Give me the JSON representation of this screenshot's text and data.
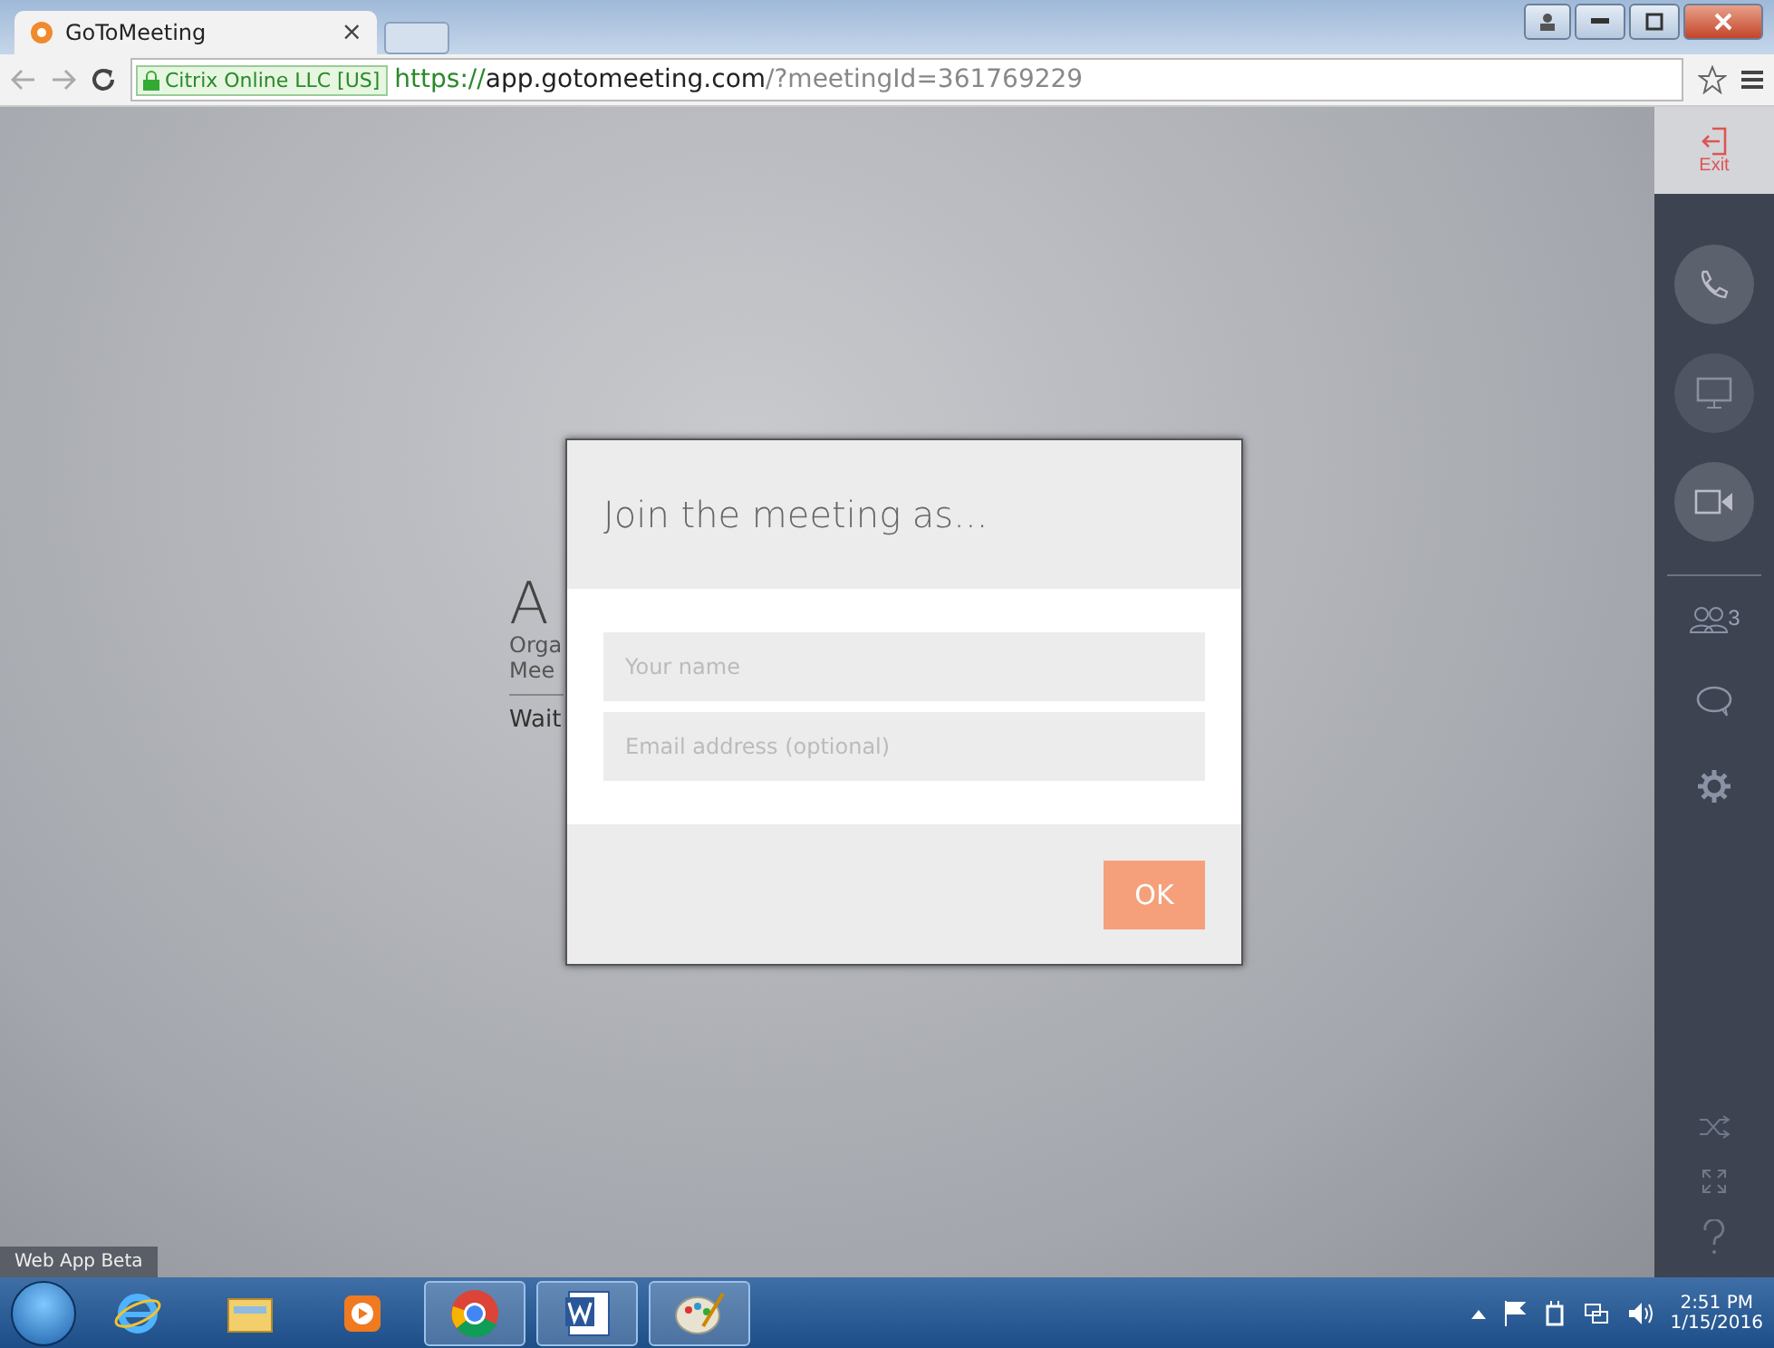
{
  "browser": {
    "tab_title": "GoToMeeting",
    "tab_close": "×",
    "security_badge": "Citrix Online LLC [US]",
    "url_scheme": "https://",
    "url_host": "app.gotomeeting.com",
    "url_path": "/?meetingId=361769229"
  },
  "sidebar": {
    "exit_label": "Exit",
    "attendee_count": "3"
  },
  "background_info": {
    "title": "A",
    "line_1": "Orga",
    "line_2": "Mee",
    "status": "Wait"
  },
  "dialog": {
    "title": "Join the meeting as...",
    "fields": [
      {
        "placeholder": "Your name"
      },
      {
        "placeholder": "Email address (optional)"
      }
    ],
    "ok_button": "OK"
  },
  "footer_label": "Web App Beta",
  "taskbar": {
    "apps": [
      {
        "kind": "ie",
        "selected": false
      },
      {
        "kind": "explorer",
        "selected": false
      },
      {
        "kind": "media",
        "selected": false
      },
      {
        "kind": "chrome",
        "selected": true
      },
      {
        "kind": "word",
        "selected": true
      },
      {
        "kind": "paint",
        "selected": true
      }
    ],
    "time": "2:51 PM",
    "date": "1/15/2016"
  }
}
